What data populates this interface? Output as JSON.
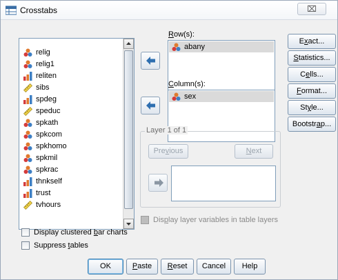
{
  "window": {
    "title": "Crosstabs",
    "close_symbol": "⌧"
  },
  "variables": [
    {
      "name": "relig",
      "icon": "nominal-icon"
    },
    {
      "name": "relig1",
      "icon": "nominal-icon"
    },
    {
      "name": "reliten",
      "icon": "ordinal-icon"
    },
    {
      "name": "sibs",
      "icon": "scale-icon"
    },
    {
      "name": "spdeg",
      "icon": "ordinal-icon"
    },
    {
      "name": "speduc",
      "icon": "scale-icon"
    },
    {
      "name": "spkath",
      "icon": "nominal-icon"
    },
    {
      "name": "spkcom",
      "icon": "nominal-icon"
    },
    {
      "name": "spkhomo",
      "icon": "nominal-icon"
    },
    {
      "name": "spkmil",
      "icon": "nominal-icon"
    },
    {
      "name": "spkrac",
      "icon": "nominal-icon"
    },
    {
      "name": "thnkself",
      "icon": "ordinal-icon"
    },
    {
      "name": "trust",
      "icon": "ordinal-icon"
    },
    {
      "name": "tvhours",
      "icon": "scale-icon"
    }
  ],
  "rows": {
    "label_pre": "",
    "label_u": "R",
    "label_post": "ow(s):",
    "items": [
      "abany"
    ]
  },
  "columns": {
    "label_pre": "",
    "label_u": "C",
    "label_post": "olumn(s):",
    "items": [
      "sex"
    ]
  },
  "layer": {
    "title": "Layer 1 of 1",
    "previous_pre": "Pre",
    "previous_u": "v",
    "previous_post": "ious",
    "next_pre": "",
    "next_u": "N",
    "next_post": "ext"
  },
  "display_layer": {
    "pre": "Dis",
    "u": "p",
    "post": "lay layer variables in table layers"
  },
  "side_buttons": [
    {
      "pre": "E",
      "u": "x",
      "post": "act..."
    },
    {
      "pre": "",
      "u": "S",
      "post": "tatistics..."
    },
    {
      "pre": "C",
      "u": "e",
      "post": "lls..."
    },
    {
      "pre": "",
      "u": "F",
      "post": "ormat..."
    },
    {
      "pre": "St",
      "u": "y",
      "post": "le..."
    },
    {
      "pre": "Bootstr",
      "u": "a",
      "post": "p..."
    }
  ],
  "checkboxes": [
    {
      "pre": "Display clustered ",
      "u": "b",
      "post": "ar charts"
    },
    {
      "pre": "Suppress ",
      "u": "t",
      "post": "ables"
    }
  ],
  "bottom_buttons": {
    "ok": "OK",
    "paste_pre": "",
    "paste_u": "P",
    "paste_post": "aste",
    "reset_pre": "",
    "reset_u": "R",
    "reset_post": "eset",
    "cancel": "Cancel",
    "help": "Help"
  }
}
